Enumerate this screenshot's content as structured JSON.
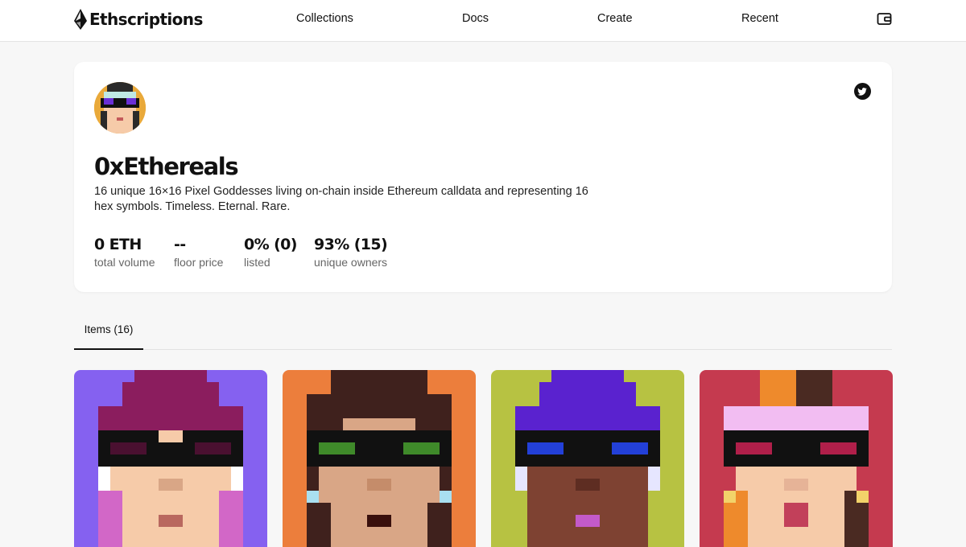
{
  "nav": {
    "brand": "Ethscriptions",
    "links": [
      "Collections",
      "Docs",
      "Create",
      "Recent"
    ]
  },
  "collection": {
    "name": "0xEthereals",
    "description": "16 unique 16×16 Pixel Goddesses living on-chain inside Ethereum calldata and representing 16 hex symbols. Timeless. Eternal. Rare.",
    "stats": [
      {
        "value": "0 ETH",
        "label": "total volume"
      },
      {
        "value": "--",
        "label": "floor price"
      },
      {
        "value": "0% (0)",
        "label": "listed"
      },
      {
        "value": "93% (15)",
        "label": "unique owners"
      }
    ]
  },
  "tabs": [
    {
      "label": "Items (16)",
      "active": true
    }
  ],
  "items": [
    {
      "bg": "#8561f0",
      "hat": "#8b1d5e",
      "glasses_lens": "#4a1030",
      "lips": "#b9685f",
      "skin": "#f6cba9"
    },
    {
      "bg": "#ec7e3c",
      "hat": "#3f211d",
      "glasses_lens": "#3f8a2a",
      "lips": "#3a100d",
      "skin": "#d9a686"
    },
    {
      "bg": "#b7c242",
      "hat": "#5a22cf",
      "glasses_lens": "#2340d8",
      "lips": "#c35ac9",
      "skin": "#7e4232"
    },
    {
      "bg": "#c53a4f",
      "hat": "#f2bdf2",
      "glasses_lens": "#b01f4a",
      "lips": "#c2405a",
      "skin": "#f6cba9"
    }
  ],
  "colors": {
    "accent": "#111111",
    "page_bg": "#f7f7f7",
    "card_bg": "#ffffff",
    "muted_text": "#666666"
  },
  "icons": [
    "ethscriptions-logo-icon",
    "wallet-icon",
    "twitter-icon"
  ]
}
